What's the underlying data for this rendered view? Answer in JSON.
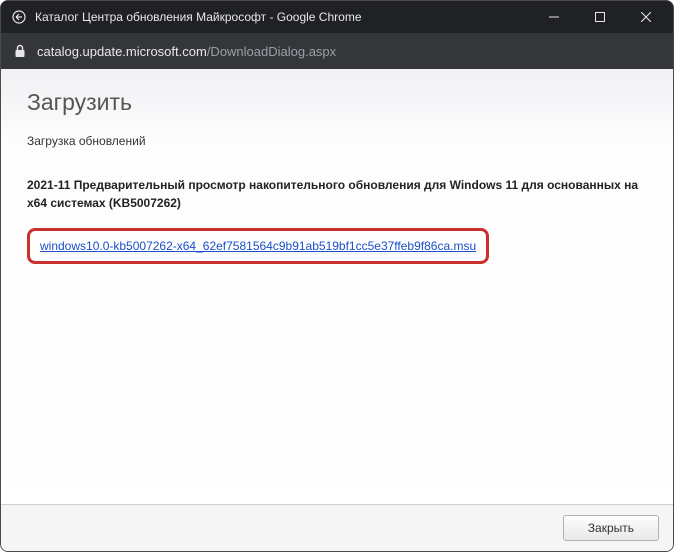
{
  "window": {
    "title": "Каталог Центра обновления Майкрософт - Google Chrome"
  },
  "addressbar": {
    "domain": "catalog.update.microsoft.com",
    "path": "/DownloadDialog.aspx"
  },
  "page": {
    "title": "Загрузить",
    "subtitle": "Загрузка обновлений",
    "update_title": "2021-11 Предварительный просмотр накопительного обновления для Windows 11 для основанных на x64 системах (KB5007262)",
    "download_link": "windows10.0-kb5007262-x64_62ef7581564c9b91ab519bf1cc5e37ffeb9f86ca.msu"
  },
  "footer": {
    "close_button": "Закрыть"
  }
}
